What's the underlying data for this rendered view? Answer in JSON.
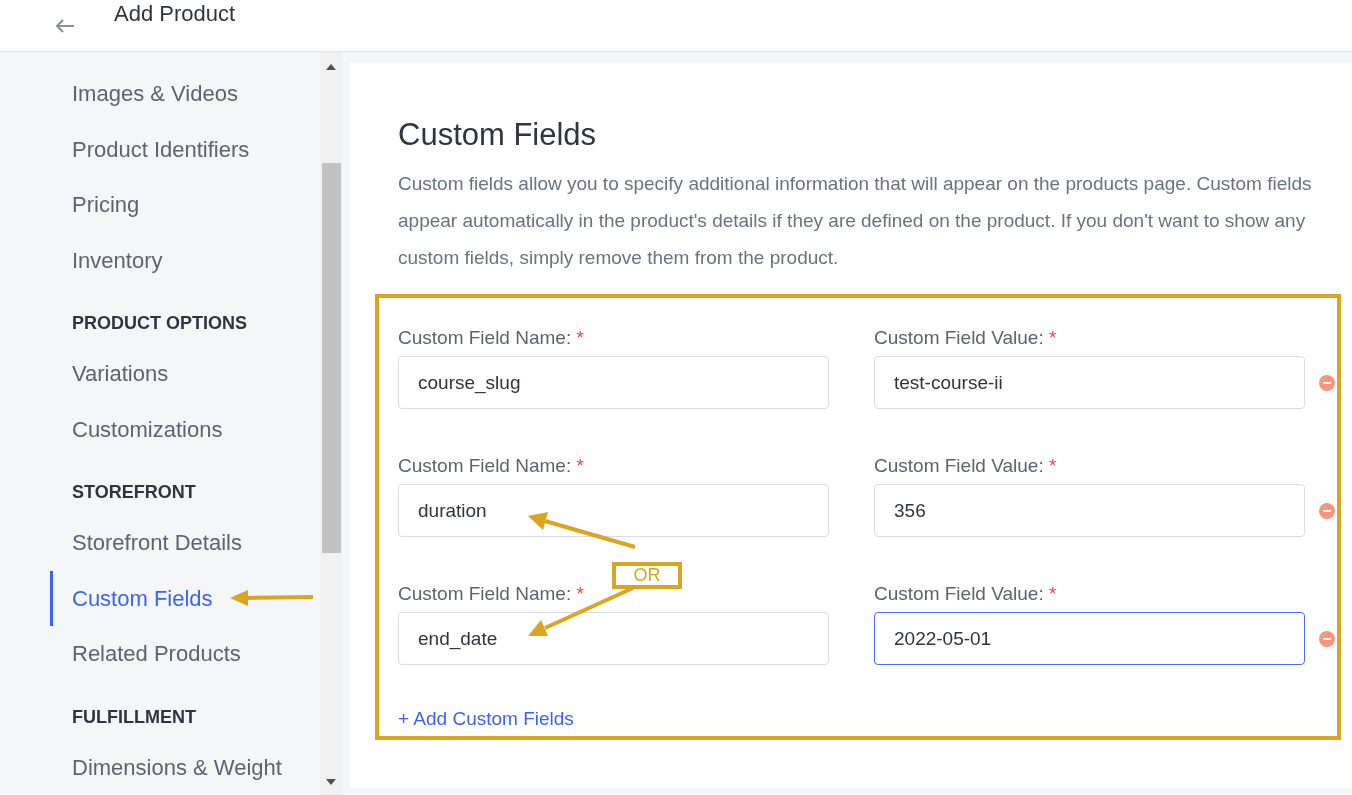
{
  "header": {
    "title": "Add Product"
  },
  "sidebar": {
    "items": [
      {
        "kind": "item",
        "label": "Images & Videos",
        "selected": false
      },
      {
        "kind": "item",
        "label": "Product Identifiers",
        "selected": false
      },
      {
        "kind": "item",
        "label": "Pricing",
        "selected": false
      },
      {
        "kind": "item",
        "label": "Inventory",
        "selected": false
      },
      {
        "kind": "section",
        "label": "PRODUCT OPTIONS"
      },
      {
        "kind": "item",
        "label": "Variations",
        "selected": false
      },
      {
        "kind": "item",
        "label": "Customizations",
        "selected": false
      },
      {
        "kind": "section",
        "label": "STOREFRONT"
      },
      {
        "kind": "item",
        "label": "Storefront Details",
        "selected": false
      },
      {
        "kind": "item",
        "label": "Custom Fields",
        "selected": true
      },
      {
        "kind": "item",
        "label": "Related Products",
        "selected": false
      },
      {
        "kind": "section",
        "label": "FULFILLMENT"
      },
      {
        "kind": "item",
        "label": "Dimensions & Weight",
        "selected": false
      }
    ]
  },
  "main": {
    "title": "Custom Fields",
    "description": "Custom fields allow you to specify additional information that will appear on the products page. Custom fields appear automatically in the product's details if they are defined on the product. If you don't want to show any custom fields, simply remove them from the product.",
    "fields": [
      {
        "name_label": "Custom Field Name:",
        "required_mark": "*",
        "name": "course_slug",
        "value_label": "Custom Field Value:",
        "value_required_mark": "*",
        "value": "test-course-ii",
        "value_focused": false
      },
      {
        "name_label": "Custom Field Name:",
        "required_mark": "*",
        "name": "duration",
        "value_label": "Custom Field Value:",
        "value_required_mark": "*",
        "value": "356",
        "value_focused": false
      },
      {
        "name_label": "Custom Field Name:",
        "required_mark": "*",
        "name": "end_date",
        "value_label": "Custom Field Value:",
        "value_required_mark": "*",
        "value": "2022-05-01",
        "value_focused": true
      }
    ],
    "add_link": "+ Add Custom Fields"
  },
  "annotations": {
    "or_label": "OR"
  }
}
